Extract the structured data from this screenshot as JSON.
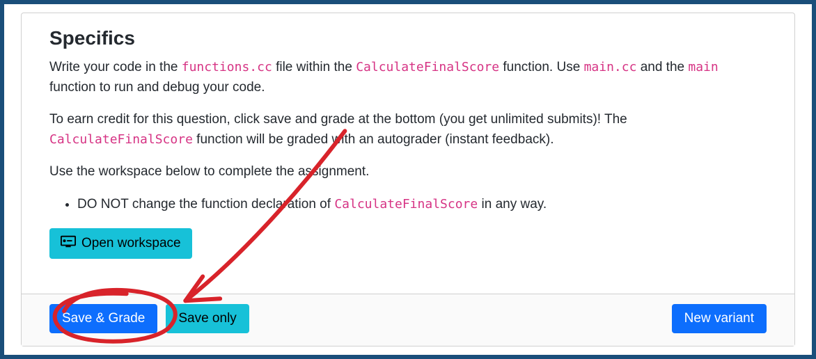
{
  "heading": "Specifics",
  "para1_parts": {
    "t1": "Write your code in the ",
    "c1": "functions.cc",
    "t2": " file within the ",
    "c2": "CalculateFinalScore",
    "t3": " function. Use ",
    "c3": "main.cc",
    "t4": " and the ",
    "c4": "main",
    "t5": " function to run and debug your code."
  },
  "para2_parts": {
    "t1": "To earn credit for this question, click save and grade at the bottom (you get unlimited submits)! The ",
    "c1": "CalculateFinalScore",
    "t2": " function will be graded with an autograder (instant feedback)."
  },
  "para3": "Use the workspace below to complete the assignment.",
  "bullet1_parts": {
    "t1": "DO NOT change the function declaration of ",
    "c1": "CalculateFinalScore",
    "t2": " in any way."
  },
  "buttons": {
    "open_workspace": "Open workspace",
    "save_grade": "Save & Grade",
    "save_only": "Save only",
    "new_variant": "New variant"
  },
  "annotation": {
    "color": "#d8232a"
  }
}
